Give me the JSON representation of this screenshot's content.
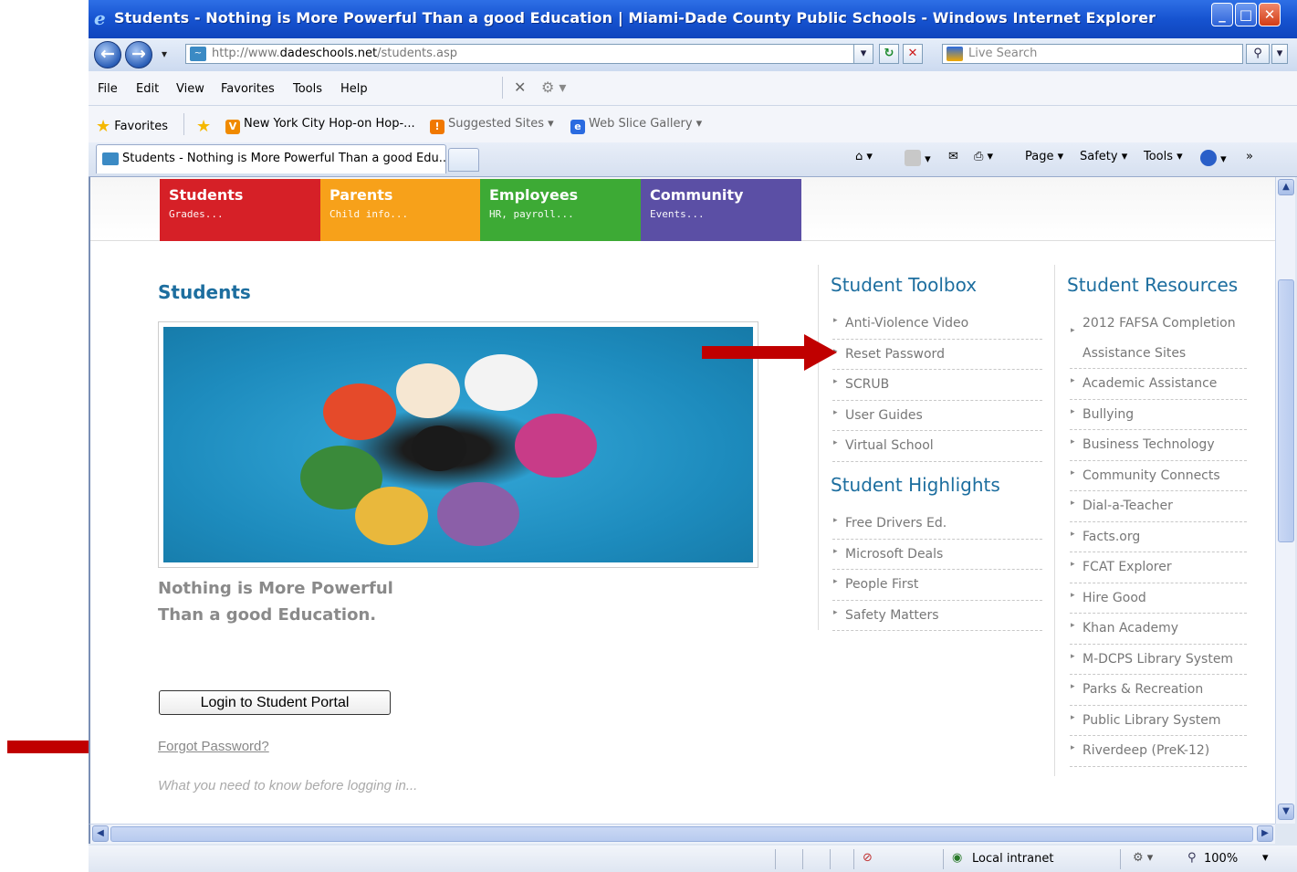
{
  "window": {
    "title": "Students - Nothing is More Powerful Than a good Education | Miami-Dade County Public Schools - Windows Internet Explorer",
    "min": "_",
    "max": "□",
    "close": "✕"
  },
  "address": {
    "url_prefix": "http://www.",
    "url_domain": "dadeschools.net",
    "url_path": "/students.asp",
    "search_placeholder": "Live Search"
  },
  "menu": [
    "File",
    "Edit",
    "View",
    "Favorites",
    "Tools",
    "Help"
  ],
  "favorites_bar": {
    "favorites_label": "Favorites",
    "items": [
      "New York City Hop-on Hop-...",
      "Suggested Sites ▾",
      "Web Slice Gallery ▾"
    ]
  },
  "tab": {
    "title": "Students - Nothing is More Powerful Than a good Edu..."
  },
  "command_bar": {
    "page": "Page ▾",
    "safety": "Safety ▾",
    "tools": "Tools ▾"
  },
  "nav_tabs": [
    {
      "title": "Students",
      "sub": "Grades...",
      "color": "#d62027"
    },
    {
      "title": "Parents",
      "sub": "Child info...",
      "color": "#f7a11a"
    },
    {
      "title": "Employees",
      "sub": "HR, payroll...",
      "color": "#3daa35"
    },
    {
      "title": "Community",
      "sub": "Events...",
      "color": "#5b4fa5"
    }
  ],
  "main": {
    "heading": "Students",
    "tagline_1": "Nothing is More Powerful",
    "tagline_2": "Than a good Education.",
    "login_button": "Login to Student Portal",
    "forgot_link": "Forgot Password?",
    "what_to_know": "What you need to know before logging in...",
    "cutoff_text": "..."
  },
  "toolbox": {
    "heading": "Student Toolbox",
    "items": [
      "Anti-Violence Video",
      "Reset Password",
      "SCRUB",
      "User Guides",
      "Virtual School"
    ]
  },
  "highlights": {
    "heading": "Student Highlights",
    "items": [
      "Free Drivers Ed.",
      "Microsoft Deals",
      "People First",
      "Safety Matters"
    ]
  },
  "resources": {
    "heading": "Student Resources",
    "items": [
      "2012 FAFSA Completion Assistance Sites",
      "Academic Assistance",
      "Bullying",
      "Business Technology",
      "Community Connects",
      "Dial-a-Teacher",
      "Facts.org",
      "FCAT Explorer",
      "Hire Good",
      "Khan Academy",
      "M-DCPS Library System",
      "Parks & Recreation",
      "Public Library System",
      "Riverdeep (PreK-12)"
    ]
  },
  "status": {
    "zone": "Local intranet",
    "zoom": "100%"
  },
  "colors": {
    "accent_blue": "#1d6e9f",
    "annotation_arrow": "#c00000"
  }
}
